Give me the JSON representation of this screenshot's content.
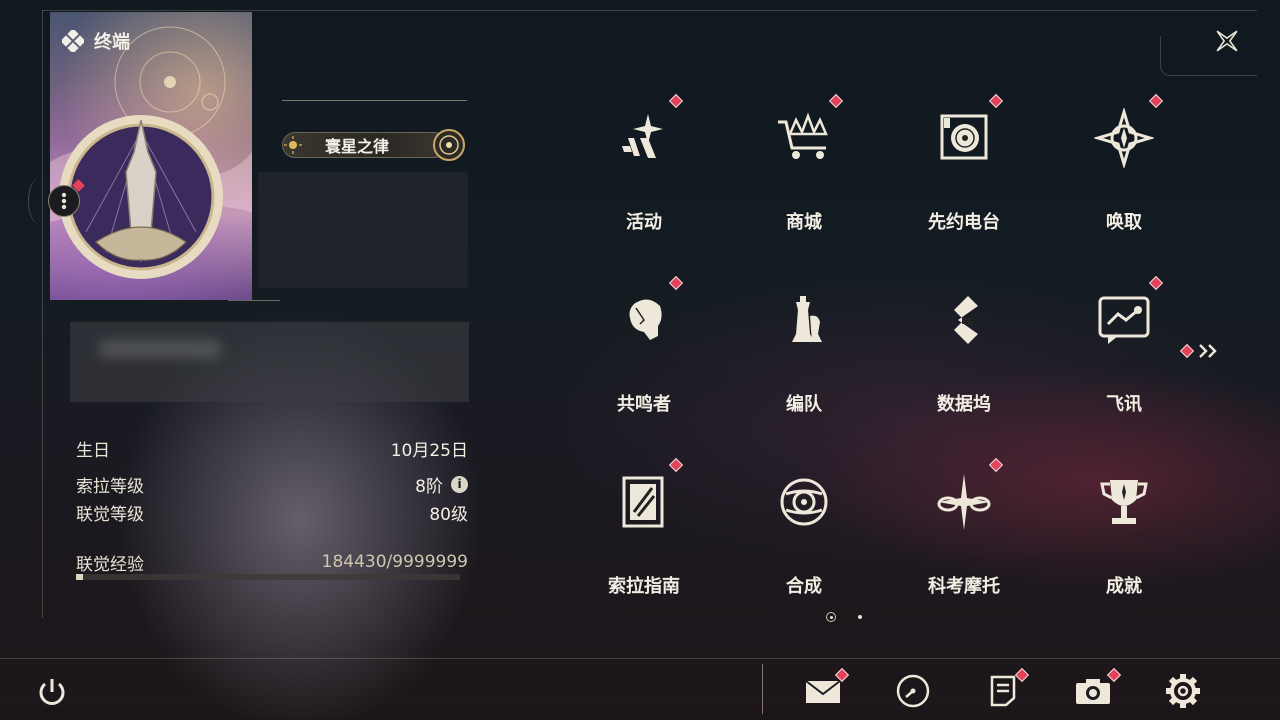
{
  "header": {
    "title": "终端"
  },
  "profile": {
    "title_badge": "寰星之律",
    "stats": {
      "birthday_label": "生日",
      "birthday_value": "10月25日",
      "sola_rank_label": "索拉等级",
      "sola_rank_value": "8阶",
      "union_level_label": "联觉等级",
      "union_level_value": "80级",
      "union_exp_label": "联觉经验",
      "union_exp_value": "184430/9999999",
      "union_exp_progress": 0.0184
    }
  },
  "menu": {
    "items": [
      {
        "label": "活动",
        "icon": "sparkle-icon",
        "badge": true
      },
      {
        "label": "商城",
        "icon": "shopping-cart-icon",
        "badge": true
      },
      {
        "label": "先约电台",
        "icon": "radio-record-icon",
        "badge": true
      },
      {
        "label": "唤取",
        "icon": "compass-star-icon",
        "badge": true
      },
      {
        "label": "共鸣者",
        "icon": "character-head-icon",
        "badge": true
      },
      {
        "label": "编队",
        "icon": "chess-pieces-icon",
        "badge": false
      },
      {
        "label": "数据坞",
        "icon": "data-dock-icon",
        "badge": false
      },
      {
        "label": "飞讯",
        "icon": "message-icon",
        "badge": true
      },
      {
        "label": "索拉指南",
        "icon": "guide-book-icon",
        "badge": true
      },
      {
        "label": "合成",
        "icon": "synthesis-icon",
        "badge": false
      },
      {
        "label": "科考摩托",
        "icon": "motorcycle-icon",
        "badge": true
      },
      {
        "label": "成就",
        "icon": "trophy-icon",
        "badge": false
      }
    ],
    "page_count": 2,
    "current_page": 1
  },
  "bottom": {
    "buttons": [
      "mail-icon",
      "clock-icon",
      "notice-icon",
      "camera-icon",
      "settings-gear-icon"
    ]
  },
  "colors": {
    "accent_red": "#e2435a",
    "text_light": "#f2eee4",
    "frame_gold": "#c8be9f"
  }
}
